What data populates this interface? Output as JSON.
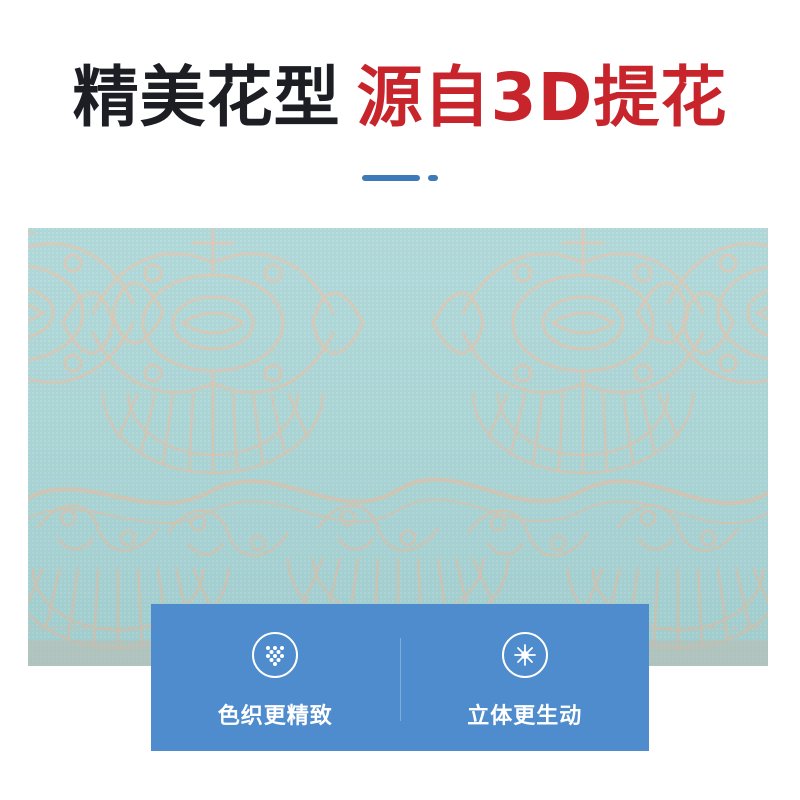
{
  "header": {
    "title_dark": "精美花型",
    "title_red": "源自3D提花"
  },
  "features": [
    {
      "label": "色织更精致",
      "icon": "dot-grid-icon"
    },
    {
      "label": "立体更生动",
      "icon": "flower-icon"
    }
  ],
  "colors": {
    "accent_blue": "#4e8ccd",
    "title_red": "#c7242c",
    "title_dark": "#1d1d24",
    "fabric_teal": "#a9d3d4",
    "fabric_pattern": "#d4c6b4"
  }
}
